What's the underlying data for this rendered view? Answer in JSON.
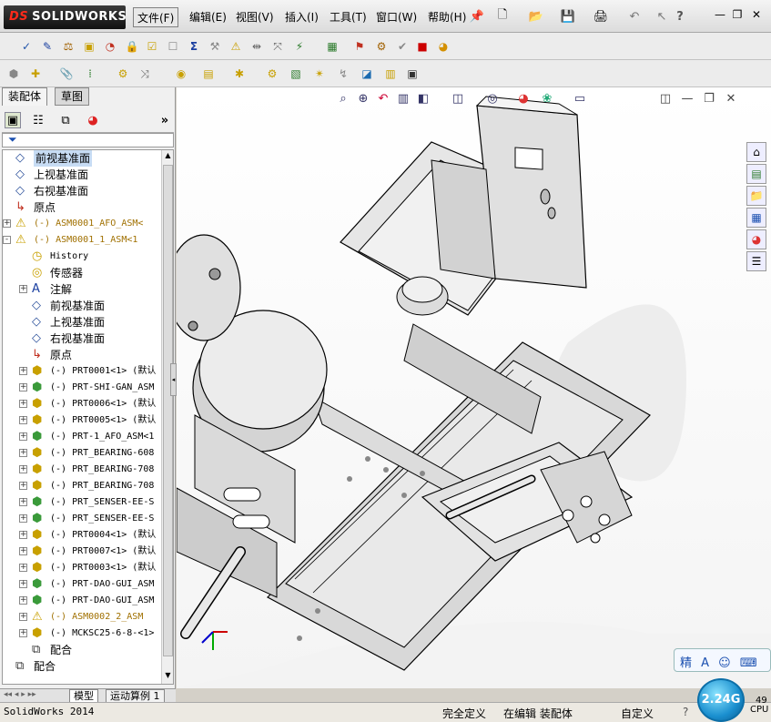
{
  "app": {
    "logo_brand": "SOLIDWORKS",
    "logo_mark": "DS"
  },
  "menu": [
    {
      "label": "文件(F)",
      "active": true
    },
    {
      "label": "编辑(E)"
    },
    {
      "label": "视图(V)"
    },
    {
      "label": "插入(I)"
    },
    {
      "label": "工具(T)"
    },
    {
      "label": "窗口(W)"
    },
    {
      "label": "帮助(H)"
    }
  ],
  "left_panel": {
    "tabs": [
      "装配体",
      "草图"
    ],
    "filter_icon": "funnel-icon"
  },
  "tree": [
    {
      "indent": 0,
      "expander": "",
      "icon": "plane",
      "label": "前视基准面",
      "selected": true
    },
    {
      "indent": 0,
      "expander": "",
      "icon": "plane",
      "label": "上视基准面"
    },
    {
      "indent": 0,
      "expander": "",
      "icon": "plane",
      "label": "右视基准面"
    },
    {
      "indent": 0,
      "expander": "",
      "icon": "origin",
      "label": "原点"
    },
    {
      "indent": 0,
      "expander": "+",
      "icon": "asm-warn",
      "label": "(-) ASM0001_AFO_ASM<",
      "style": "warn"
    },
    {
      "indent": 0,
      "expander": "-",
      "icon": "asm-warn",
      "label": "(-) ASM0001_1_ASM<1",
      "style": "warn"
    },
    {
      "indent": 1,
      "expander": "",
      "icon": "history",
      "label": "History",
      "style": "mono"
    },
    {
      "indent": 1,
      "expander": "",
      "icon": "sensor",
      "label": "传感器"
    },
    {
      "indent": 1,
      "expander": "+",
      "icon": "annot",
      "label": "注解"
    },
    {
      "indent": 1,
      "expander": "",
      "icon": "plane",
      "label": "前视基准面"
    },
    {
      "indent": 1,
      "expander": "",
      "icon": "plane",
      "label": "上视基准面"
    },
    {
      "indent": 1,
      "expander": "",
      "icon": "plane",
      "label": "右视基准面"
    },
    {
      "indent": 1,
      "expander": "",
      "icon": "origin",
      "label": "原点"
    },
    {
      "indent": 1,
      "expander": "+",
      "icon": "part",
      "label": "(-) PRT0001<1> (默认",
      "style": "mono"
    },
    {
      "indent": 1,
      "expander": "+",
      "icon": "asm",
      "label": "(-) PRT-SHI-GAN_ASM",
      "style": "mono"
    },
    {
      "indent": 1,
      "expander": "+",
      "icon": "part",
      "label": "(-) PRT0006<1> (默认",
      "style": "mono"
    },
    {
      "indent": 1,
      "expander": "+",
      "icon": "part",
      "label": "(-) PRT0005<1> (默认",
      "style": "mono"
    },
    {
      "indent": 1,
      "expander": "+",
      "icon": "asm",
      "label": "(-) PRT-1_AFO_ASM<1",
      "style": "mono"
    },
    {
      "indent": 1,
      "expander": "+",
      "icon": "part",
      "label": "(-) PRT_BEARING-608",
      "style": "mono"
    },
    {
      "indent": 1,
      "expander": "+",
      "icon": "part",
      "label": "(-) PRT_BEARING-708",
      "style": "mono"
    },
    {
      "indent": 1,
      "expander": "+",
      "icon": "part",
      "label": "(-) PRT_BEARING-708",
      "style": "mono"
    },
    {
      "indent": 1,
      "expander": "+",
      "icon": "asm",
      "label": "(-) PRT_SENSER-EE-S",
      "style": "mono"
    },
    {
      "indent": 1,
      "expander": "+",
      "icon": "asm",
      "label": "(-) PRT_SENSER-EE-S",
      "style": "mono"
    },
    {
      "indent": 1,
      "expander": "+",
      "icon": "part",
      "label": "(-) PRT0004<1> (默认",
      "style": "mono"
    },
    {
      "indent": 1,
      "expander": "+",
      "icon": "part",
      "label": "(-) PRT0007<1> (默认",
      "style": "mono"
    },
    {
      "indent": 1,
      "expander": "+",
      "icon": "part",
      "label": "(-) PRT0003<1> (默认",
      "style": "mono"
    },
    {
      "indent": 1,
      "expander": "+",
      "icon": "asm",
      "label": "(-) PRT-DAO-GUI_ASM",
      "style": "mono"
    },
    {
      "indent": 1,
      "expander": "+",
      "icon": "asm",
      "label": "(-) PRT-DAO-GUI_ASM",
      "style": "mono"
    },
    {
      "indent": 1,
      "expander": "+",
      "icon": "asm-warn",
      "label": "(-) ASM0002_2_ASM",
      "style": "warn"
    },
    {
      "indent": 1,
      "expander": "+",
      "icon": "part",
      "label": "(-) MCKSC25-6-8-<1>",
      "style": "mono"
    },
    {
      "indent": 1,
      "expander": "",
      "icon": "mate",
      "label": "配合"
    },
    {
      "indent": 0,
      "expander": "",
      "icon": "mate",
      "label": "配合"
    }
  ],
  "bottom_tabs": [
    "模型",
    "运动算例 1"
  ],
  "status": {
    "app_version": "SolidWorks 2014",
    "state": "完全定义",
    "mode": "在编辑 装配体",
    "custom": "自定义",
    "speed": "2.24G",
    "cpu_label": "CPU",
    "cpu_value": "49"
  },
  "ime": {
    "chars": "精 A ☺ ⌨"
  }
}
